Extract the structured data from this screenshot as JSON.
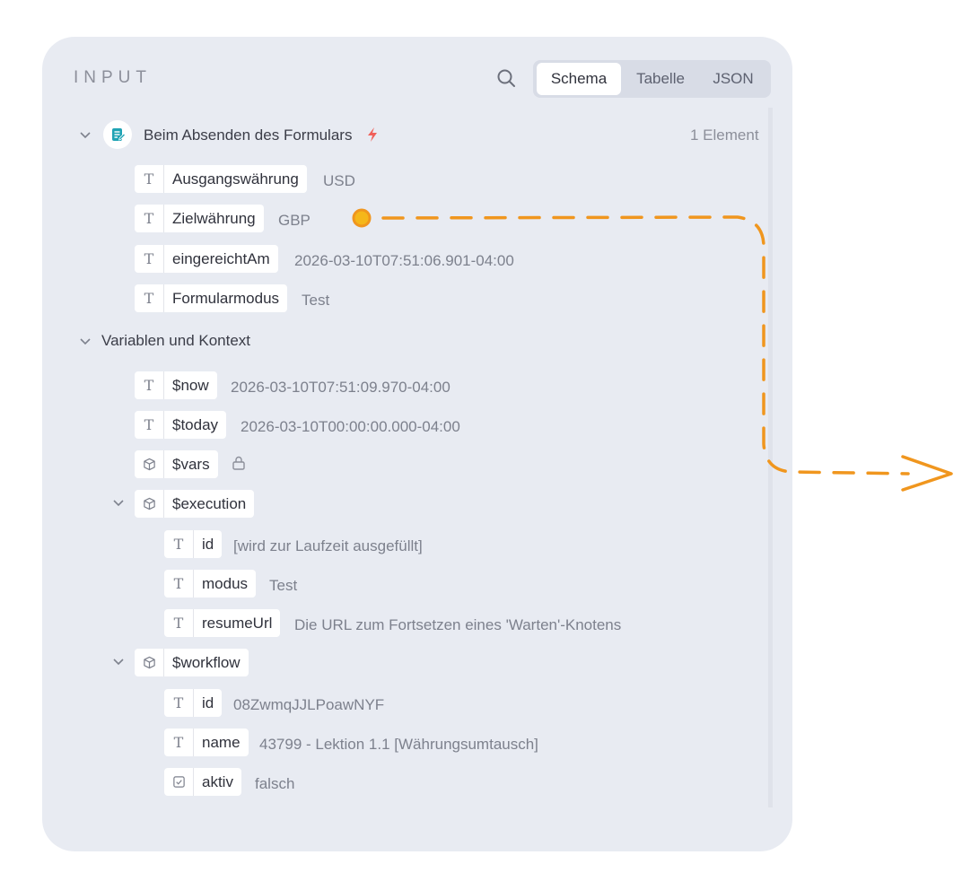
{
  "panel": {
    "title": "INPUT",
    "tabs": [
      {
        "label": "Schema",
        "active": true
      },
      {
        "label": "Tabelle",
        "active": false
      },
      {
        "label": "JSON",
        "active": false
      }
    ]
  },
  "trigger": {
    "title": "Beim Absenden des Formulars",
    "count_label": "1 Element",
    "fields": [
      {
        "type": "text",
        "name": "Ausgangswährung",
        "value": "USD"
      },
      {
        "type": "text",
        "name": "Zielwährung",
        "value": "GBP"
      },
      {
        "type": "text",
        "name": "eingereichtAm",
        "value": "2026-03-10T07:51:06.901-04:00"
      },
      {
        "type": "text",
        "name": "Formularmodus",
        "value": "Test"
      }
    ]
  },
  "variables": {
    "title": "Variablen und Kontext",
    "items": [
      {
        "type": "text",
        "name": "$now",
        "value": "2026-03-10T07:51:09.970-04:00"
      },
      {
        "type": "text",
        "name": "$today",
        "value": "2026-03-10T00:00:00.000-04:00"
      },
      {
        "type": "object",
        "name": "$vars",
        "value": ""
      },
      {
        "type": "object",
        "name": "$execution",
        "value": ""
      },
      {
        "type": "text",
        "name": "id",
        "value": "[wird zur Laufzeit ausgefüllt]"
      },
      {
        "type": "text",
        "name": "modus",
        "value": "Test"
      },
      {
        "type": "text",
        "name": "resumeUrl",
        "value": "Die URL zum Fortsetzen eines 'Warten'-Knotens"
      },
      {
        "type": "object",
        "name": "$workflow",
        "value": ""
      },
      {
        "type": "text",
        "name": "id",
        "value": "08ZwmqJJLPoawNYF"
      },
      {
        "type": "text",
        "name": "name",
        "value": "43799 - Lektion 1.1 [Währungsumtausch]"
      },
      {
        "type": "boolean",
        "name": "aktiv",
        "value": "falsch"
      }
    ]
  },
  "colors": {
    "panel_bg": "#e8ebf2",
    "annotation": "#f0961e",
    "trigger_icon": "#1fa3b4",
    "bolt": "#f0605a"
  }
}
